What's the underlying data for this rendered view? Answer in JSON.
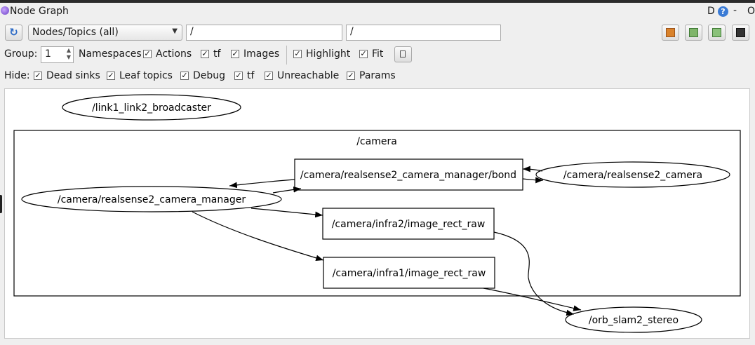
{
  "window": {
    "title": "Node Graph",
    "d_label": "D",
    "help_label": "?",
    "min_label": "-",
    "close_label": "O"
  },
  "toolbar": {
    "refresh_icon": "↻",
    "graph_mode": "Nodes/Topics (all)",
    "node_filter": "/",
    "topic_filter": "/",
    "icons": [
      "load-icon",
      "save-dot-icon",
      "save-svg-icon",
      "screenshot-icon"
    ]
  },
  "options": {
    "group_label": "Group:",
    "group_value": "1",
    "namespaces": "Namespaces",
    "actions": "Actions",
    "tf": "tf",
    "images": "Images",
    "highlight": "Highlight",
    "fit": "Fit"
  },
  "hide": {
    "label": "Hide:",
    "dead_sinks": "Dead sinks",
    "leaf_topics": "Leaf topics",
    "debug": "Debug",
    "tf": "tf",
    "unreachable": "Unreachable",
    "params": "Params"
  },
  "graph": {
    "nodes": {
      "broadcaster": "/link1_link2_broadcaster",
      "camera_manager": "/camera/realsense2_camera_manager",
      "camera": "/camera/realsense2_camera",
      "orb_slam": "/orb_slam2_stereo"
    },
    "topics": {
      "bond": "/camera/realsense2_camera_manager/bond",
      "infra2": "/camera/infra2/image_rect_raw",
      "infra1": "/camera/infra1/image_rect_raw"
    },
    "cluster_label": "/camera"
  }
}
